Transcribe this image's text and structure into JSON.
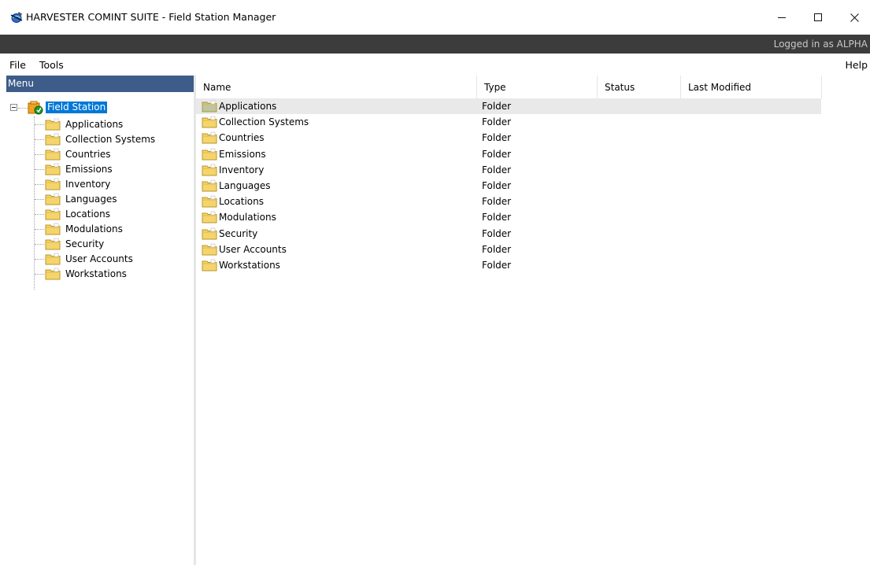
{
  "window": {
    "title": "HARVESTER COMINT SUITE - Field Station Manager",
    "app_icon": "globe-satellite-icon"
  },
  "status": {
    "logged_in_text": "Logged in as ALPHA"
  },
  "menubar": {
    "file": "File",
    "tools": "Tools",
    "help": "Help"
  },
  "left_panel": {
    "header": "Menu",
    "root": {
      "label": "Field Station",
      "icon": "field-station-icon",
      "expanded": true
    },
    "items": [
      {
        "label": "Applications",
        "icon": "folder-icon"
      },
      {
        "label": "Collection Systems",
        "icon": "folder-icon"
      },
      {
        "label": "Countries",
        "icon": "folder-icon"
      },
      {
        "label": "Emissions",
        "icon": "folder-icon"
      },
      {
        "label": "Inventory",
        "icon": "folder-icon"
      },
      {
        "label": "Languages",
        "icon": "folder-icon"
      },
      {
        "label": "Locations",
        "icon": "folder-icon"
      },
      {
        "label": "Modulations",
        "icon": "folder-icon"
      },
      {
        "label": "Security",
        "icon": "folder-icon"
      },
      {
        "label": "User Accounts",
        "icon": "folder-icon"
      },
      {
        "label": "Workstations",
        "icon": "folder-icon"
      }
    ]
  },
  "list": {
    "columns": [
      "Name",
      "Type",
      "Status",
      "Last Modified"
    ],
    "rows": [
      {
        "name": "Applications",
        "type": "Folder",
        "status": "",
        "modified": "",
        "selected": true
      },
      {
        "name": "Collection Systems",
        "type": "Folder",
        "status": "",
        "modified": ""
      },
      {
        "name": "Countries",
        "type": "Folder",
        "status": "",
        "modified": ""
      },
      {
        "name": "Emissions",
        "type": "Folder",
        "status": "",
        "modified": ""
      },
      {
        "name": "Inventory",
        "type": "Folder",
        "status": "",
        "modified": ""
      },
      {
        "name": "Languages",
        "type": "Folder",
        "status": "",
        "modified": ""
      },
      {
        "name": "Locations",
        "type": "Folder",
        "status": "",
        "modified": ""
      },
      {
        "name": "Modulations",
        "type": "Folder",
        "status": "",
        "modified": ""
      },
      {
        "name": "Security",
        "type": "Folder",
        "status": "",
        "modified": ""
      },
      {
        "name": "User Accounts",
        "type": "Folder",
        "status": "",
        "modified": ""
      },
      {
        "name": "Workstations",
        "type": "Folder",
        "status": "",
        "modified": ""
      }
    ]
  },
  "colors": {
    "menu_header_bg": "#3d5c8a",
    "status_strip_bg": "#3c3c3c",
    "selection_blue": "#0078d7",
    "folder_yellow": "#f5d56b"
  }
}
